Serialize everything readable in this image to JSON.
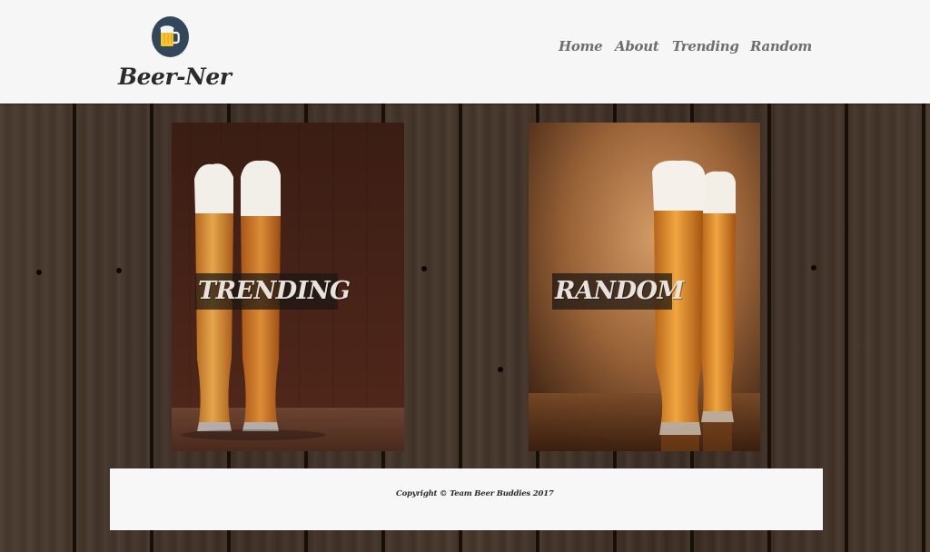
{
  "brand": {
    "name": "Beer-Ner",
    "logo_icon": "beer-mug-icon",
    "logo_color": "#33475b"
  },
  "nav": {
    "items": [
      {
        "label": "Home"
      },
      {
        "label": "About"
      },
      {
        "label": "Trending"
      },
      {
        "label": "Random"
      }
    ]
  },
  "cards": {
    "trending": {
      "label": "TRENDING",
      "image": "two tall wheat beer glasses on wood"
    },
    "random": {
      "label": "RANDOM",
      "image": "two tall lager glasses on amber background"
    }
  },
  "footer": {
    "copyright": "Copyright © Team Beer Buddies 2017"
  },
  "colors": {
    "header_bg": "#f6f6f6",
    "nav_text": "#6e6e6e",
    "brand_text": "#2b2b2b",
    "wood_dark": "#3d2f25",
    "label_bg": "rgba(28,22,18,.72)"
  }
}
